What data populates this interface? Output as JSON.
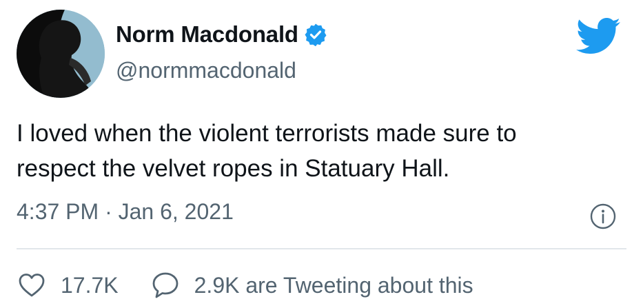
{
  "author": {
    "display_name": "Norm Macdonald",
    "handle": "@normmacdonald",
    "verified": true
  },
  "tweet": {
    "text": "I loved when the violent terrorists made sure to\nrespect the velvet ropes in Statuary Hall.",
    "timestamp": "4:37 PM · Jan 6, 2021"
  },
  "actions": {
    "likes": "17.7K",
    "tweeting_about": "2.9K are Tweeting about this"
  },
  "icons": {
    "brand": "twitter-bird-icon",
    "verified": "verified-badge-icon",
    "info": "info-icon",
    "like": "heart-icon",
    "reply": "speech-bubble-icon"
  },
  "colors": {
    "brand": "#1d9bf0",
    "text_primary": "#0f1419",
    "text_secondary": "#536471",
    "divider": "#e1e6ea"
  }
}
